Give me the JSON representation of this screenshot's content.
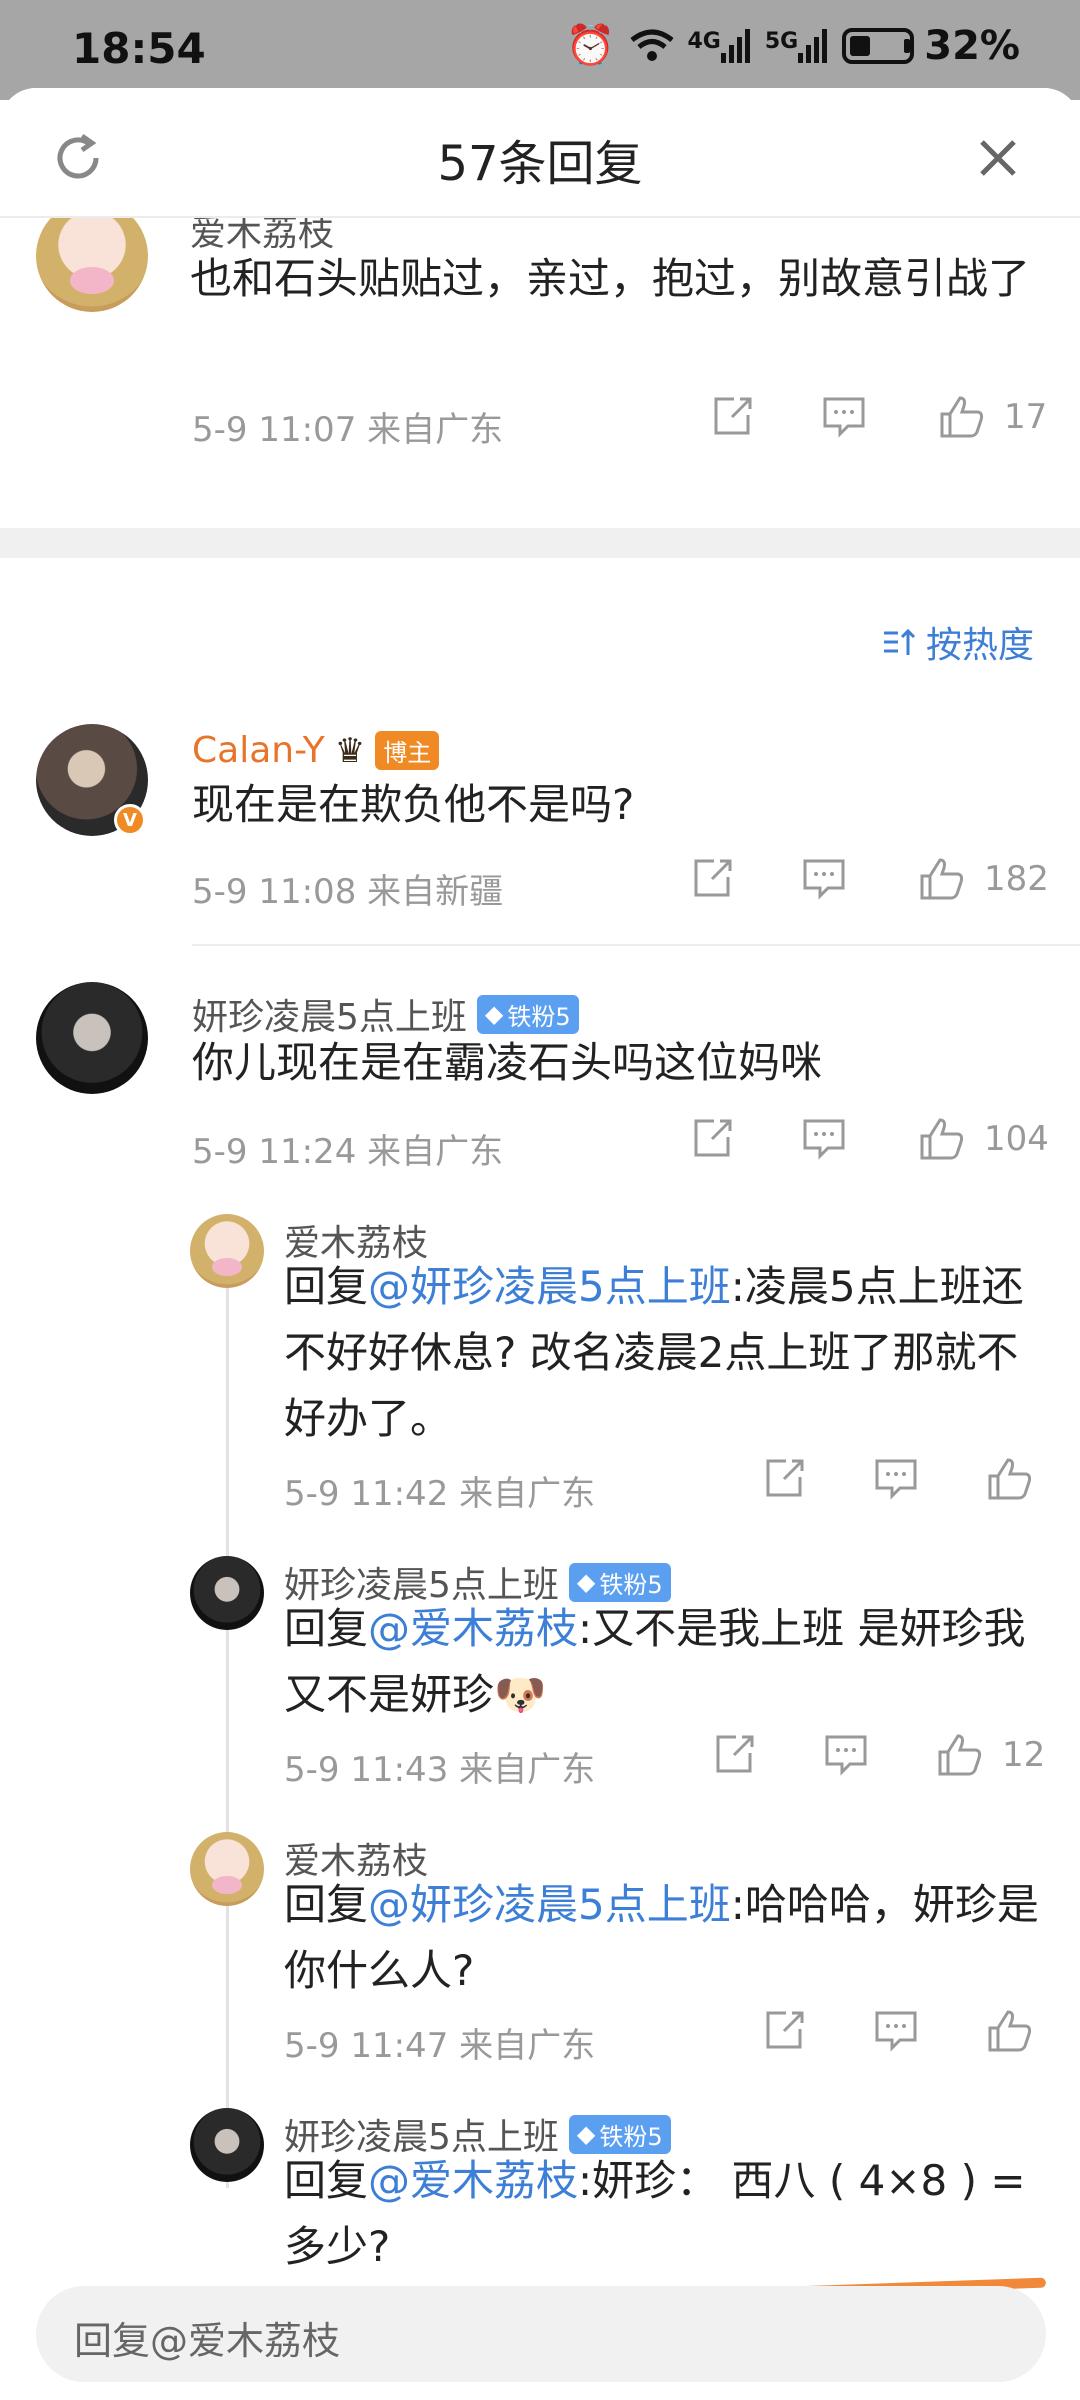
{
  "status_bar": {
    "time": "18:54",
    "signal_4g": "4G",
    "signal_5g": "5G",
    "battery": "32%"
  },
  "header": {
    "title": "57条回复"
  },
  "sort": {
    "label": "按热度"
  },
  "comments": [
    {
      "user": "爱木荔枝",
      "text": "也和石头贴贴过，亲过，抱过，别故意引战了",
      "meta": "5-9 11:07  来自广东",
      "likes": "17"
    },
    {
      "user": "Calan-Y",
      "badge": "博主",
      "text": "现在是在欺负他不是吗?",
      "meta": "5-9 11:08  来自新疆",
      "likes": "182"
    },
    {
      "user": "妍珍凌晨5点上班",
      "badge": "铁粉5",
      "text": "你儿现在是在霸凌石头吗这位妈咪",
      "meta": "5-9 11:24  来自广东",
      "likes": "104"
    }
  ],
  "replies": [
    {
      "user": "爱木荔枝",
      "prefix": "回复",
      "mention": "@妍珍凌晨5点上班",
      "text": ":凌晨5点上班还不好好休息? 改名凌晨2点上班了那就不好办了。",
      "meta": "5-9 11:42  来自广东",
      "likes": ""
    },
    {
      "user": "妍珍凌晨5点上班",
      "badge": "铁粉5",
      "prefix": "回复",
      "mention": "@爱木荔枝",
      "text": ":又不是我上班 是妍珍我又不是妍珍🐶",
      "meta": "5-9 11:43  来自广东",
      "likes": "12"
    },
    {
      "user": "爱木荔枝",
      "prefix": "回复",
      "mention": "@妍珍凌晨5点上班",
      "text": ":哈哈哈，妍珍是你什么人?",
      "meta": "5-9 11:47  来自广东",
      "likes": ""
    },
    {
      "user": "妍珍凌晨5点上班",
      "badge": "铁粉5",
      "prefix": "回复",
      "mention": "@爱木荔枝",
      "text": ":妍珍： 西八 ( 4×8 ) =多少?",
      "meta": "",
      "likes": ""
    }
  ],
  "reply_input": {
    "placeholder": "回复@爱木荔枝"
  },
  "colors": {
    "accent": "#3d7fd6",
    "orange": "#f08a24",
    "fan_badge": "#5b9ff0"
  },
  "icons": [
    "refresh-icon",
    "close-icon",
    "share-icon",
    "comment-icon",
    "like-icon",
    "sort-icon"
  ]
}
